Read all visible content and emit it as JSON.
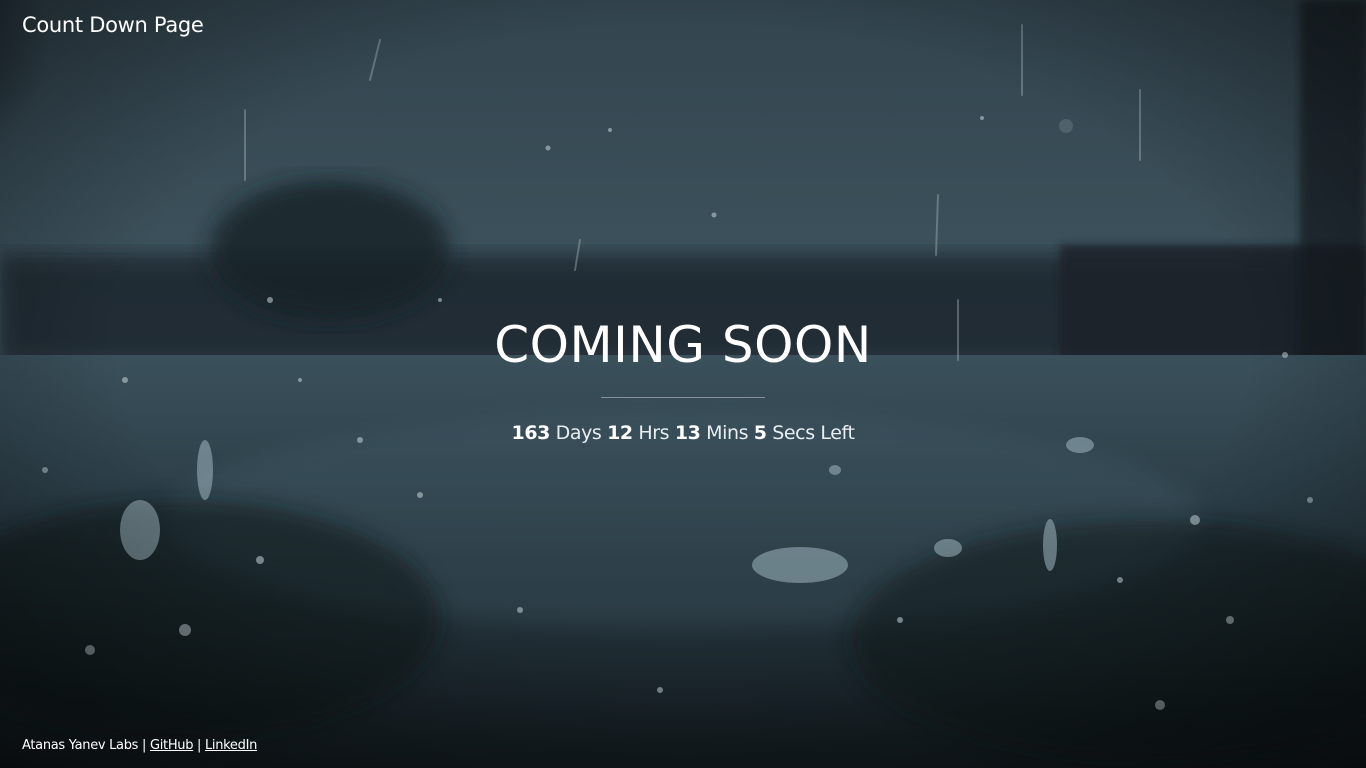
{
  "header": {
    "brand": "Count Down Page"
  },
  "hero": {
    "title": "COMING SOON",
    "countdown": {
      "days": "163",
      "days_label": "Days",
      "hours": "12",
      "hours_label": "Hrs",
      "mins": "13",
      "mins_label": "Mins",
      "secs": "5",
      "secs_label": "Secs Left"
    }
  },
  "footer": {
    "owner": "Atanas Yanev Labs",
    "separator": "|",
    "github": "GitHub",
    "linkedin": "LinkedIn"
  },
  "background": {
    "scene": "rain-on-ground-photo",
    "colors": {
      "sky": "#3d525d",
      "horizon": "#1f2a30",
      "ground": "#2e414b",
      "ground_dark": "#141d22"
    }
  }
}
